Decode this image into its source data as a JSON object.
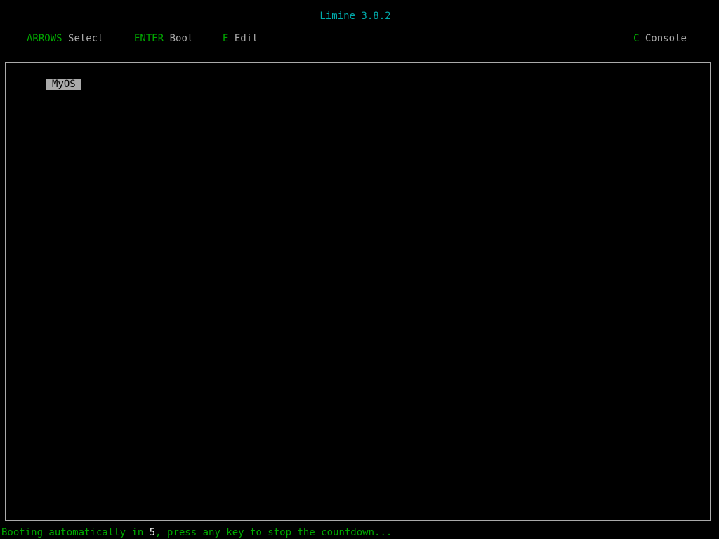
{
  "title": "Limine 3.8.2",
  "hints": {
    "select": {
      "key": "ARROWS",
      "action": "Select"
    },
    "boot": {
      "key": "ENTER",
      "action": "Boot"
    },
    "edit": {
      "key": "E",
      "action": "Edit"
    },
    "console": {
      "key": "C",
      "action": "Console"
    }
  },
  "menu": {
    "entries": [
      {
        "label": "MyOS",
        "selected": true
      }
    ]
  },
  "status": {
    "prefix": "Booting automatically in ",
    "seconds": "5",
    "suffix": ", press any key to stop the countdown..."
  },
  "colors": {
    "background": "#000000",
    "title": "#00aaaa",
    "key": "#00aa00",
    "text": "#aaaaaa",
    "selection_background": "#aaaaaa",
    "selection_text": "#000000",
    "countdown_number": "#ffffff"
  }
}
